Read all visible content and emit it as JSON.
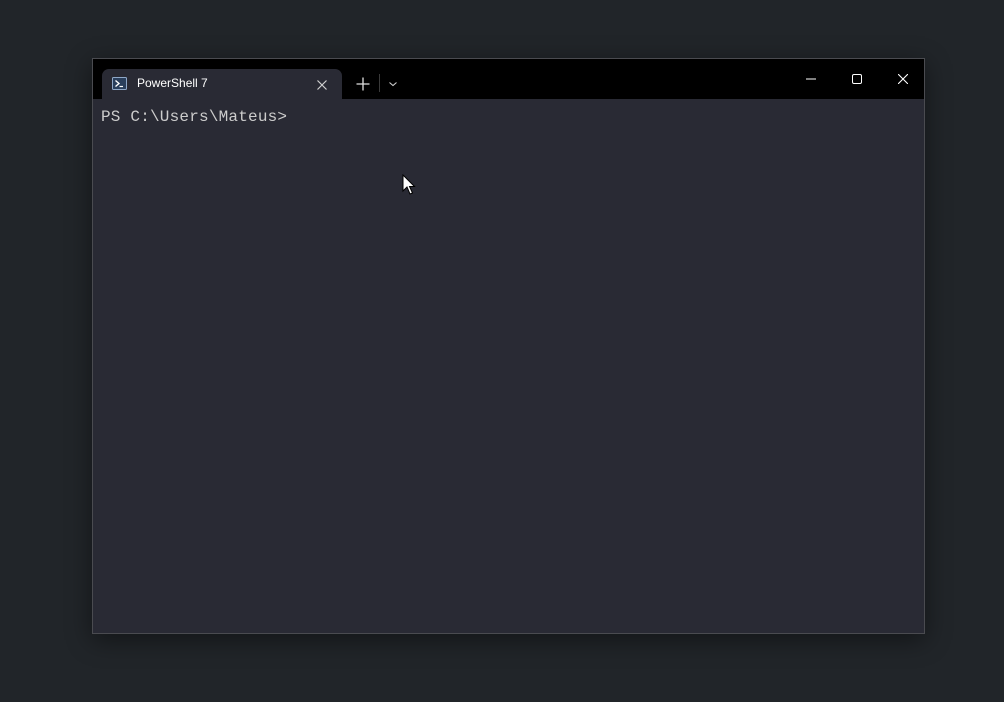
{
  "window": {
    "title_bar": {
      "tab": {
        "label": "PowerShell 7",
        "icon": "powershell-icon",
        "close_icon": "close-icon"
      },
      "new_tab_icon": "plus-icon",
      "dropdown_icon": "chevron-down-icon",
      "caption_buttons": [
        "minimize-icon",
        "maximize-icon",
        "close-icon"
      ]
    },
    "terminal": {
      "prompt": "PS C:\\Users\\Mateus>"
    }
  },
  "colors": {
    "desktop": "#212529",
    "titlebar": "#000000",
    "terminal_bg": "#292a34",
    "text": "#cccccc"
  }
}
